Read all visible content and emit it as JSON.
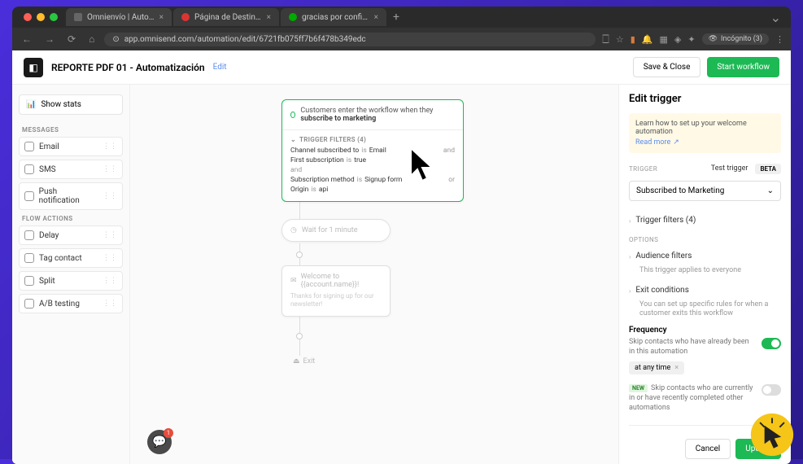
{
  "browser": {
    "tabs": [
      {
        "title": "Omnienvío | Automatización"
      },
      {
        "title": "Página de Destino - Campañ"
      },
      {
        "title": "gracias por confirmar – Tu N"
      }
    ],
    "url": "app.omnisend.com/automation/edit/6721fb075ff7b6f478b349edc",
    "incognito": "Incógnito (3)"
  },
  "topbar": {
    "title": "REPORTE PDF 01 - Automatización",
    "edit": "Edit",
    "save": "Save & Close",
    "start": "Start workflow"
  },
  "left": {
    "show_stats": "Show stats",
    "messages_title": "MESSAGES",
    "messages": [
      "Email",
      "SMS",
      "Push notification"
    ],
    "flow_title": "FLOW ACTIONS",
    "flow": [
      "Delay",
      "Tag contact",
      "Split",
      "A/B testing"
    ]
  },
  "canvas": {
    "trigger_text_a": "Customers enter the workflow when they ",
    "trigger_text_b": "subscribe to marketing",
    "filters_title": "TRIGGER FILTERS (4)",
    "filters": [
      {
        "k": "Channel subscribed to",
        "op": "is",
        "v": "Email",
        "conj": "and"
      },
      {
        "k": "First subscription",
        "op": "is",
        "v": "true",
        "conj": ""
      },
      {
        "k": "and",
        "op": "",
        "v": "",
        "conj": ""
      },
      {
        "k": "Subscription method",
        "op": "is",
        "v": "Signup form",
        "conj": "or"
      },
      {
        "k": "Origin",
        "op": "is",
        "v": "api",
        "conj": ""
      }
    ],
    "wait": "Wait for 1 minute",
    "email_subject": "Welcome to {{account.name}}!",
    "email_preview": "Thanks for signing up for our newsletter!",
    "exit": "Exit"
  },
  "right": {
    "title": "Edit trigger",
    "info_text": "Learn how to set up your welcome automation",
    "info_link": "Read more",
    "trigger_label": "TRIGGER",
    "test_trigger": "Test trigger",
    "beta": "BETA",
    "select_value": "Subscribed to Marketing",
    "filters_item": "Trigger filters (4)",
    "options_label": "OPTIONS",
    "audience_title": "Audience filters",
    "audience_sub": "This trigger applies to everyone",
    "exit_title": "Exit conditions",
    "exit_sub": "You can set up specific rules for when a customer exits this workflow",
    "freq_title": "Frequency",
    "freq_text1": "Skip contacts who have already been in this automation",
    "chip": "at any time",
    "new_label": "NEW",
    "freq_text2": "Skip contacts who are currently in or have recently completed other automations",
    "cancel": "Cancel",
    "update": "Update"
  },
  "chat_badge": "1"
}
